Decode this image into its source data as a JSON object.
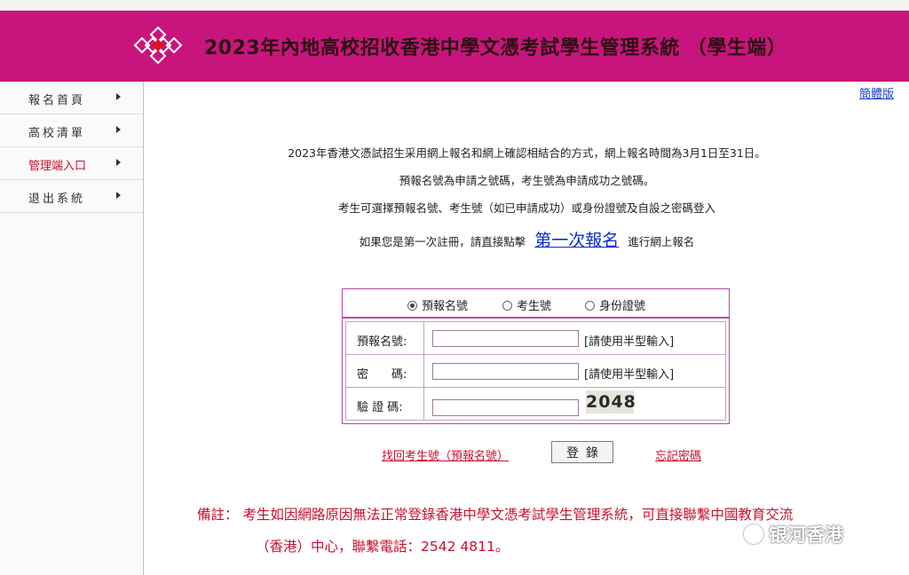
{
  "header": {
    "title": "2023年內地高校招收香港中學文憑考試學生管理系統 （學生端）"
  },
  "sidebar": {
    "items": [
      {
        "label": "報名首頁"
      },
      {
        "label": "高校清單"
      },
      {
        "label": "管理端入口"
      },
      {
        "label": "退出系統"
      }
    ],
    "active_index": 2
  },
  "lang_switch": "簡體版",
  "intro": {
    "line1": "2023年香港文憑試招生采用網上報名和網上確認相結合的方式，網上報名時間為3月1日至31日。",
    "line2": "預報名號為申請之號碼，考生號為申請成功之號碼。",
    "line3": "考生可選擇預報名號、考生號（如已申請成功）或身份證號及自設之密碼登入",
    "line4_prefix": "如果您是第一次註冊，請直接點擊",
    "line4_link": "第一次報名",
    "line4_suffix": "進行網上報名"
  },
  "login_type": {
    "options": [
      "預報名號",
      "考生號",
      "身份證號"
    ],
    "selected": "預報名號"
  },
  "form": {
    "prereg_label": "預報名號:",
    "prereg_value": "",
    "prereg_hint": "[請使用半型輸入]",
    "password_label": "密　　碼:",
    "password_value": "",
    "password_hint": "[請使用半型輸入]",
    "captcha_label": "驗 證 碼:",
    "captcha_value": "",
    "captcha_code": "2048"
  },
  "actions": {
    "recover_link": "找回考生號（預報名號）",
    "login_button": "登錄",
    "forgot_password": "忘記密碼"
  },
  "note": {
    "line1": "備註： 考生如因網路原因無法正常登錄香港中學文憑考試學生管理系統，可直接聯繫中國教育交流",
    "line2": "（香港）中心，聯繫電話：2542 4811。"
  },
  "watermark": "银河香港",
  "colors": {
    "header_bg": "#c8157d",
    "accent_red": "#c8102e",
    "link_blue": "#0a2fc8",
    "form_border": "#b44aa6"
  }
}
